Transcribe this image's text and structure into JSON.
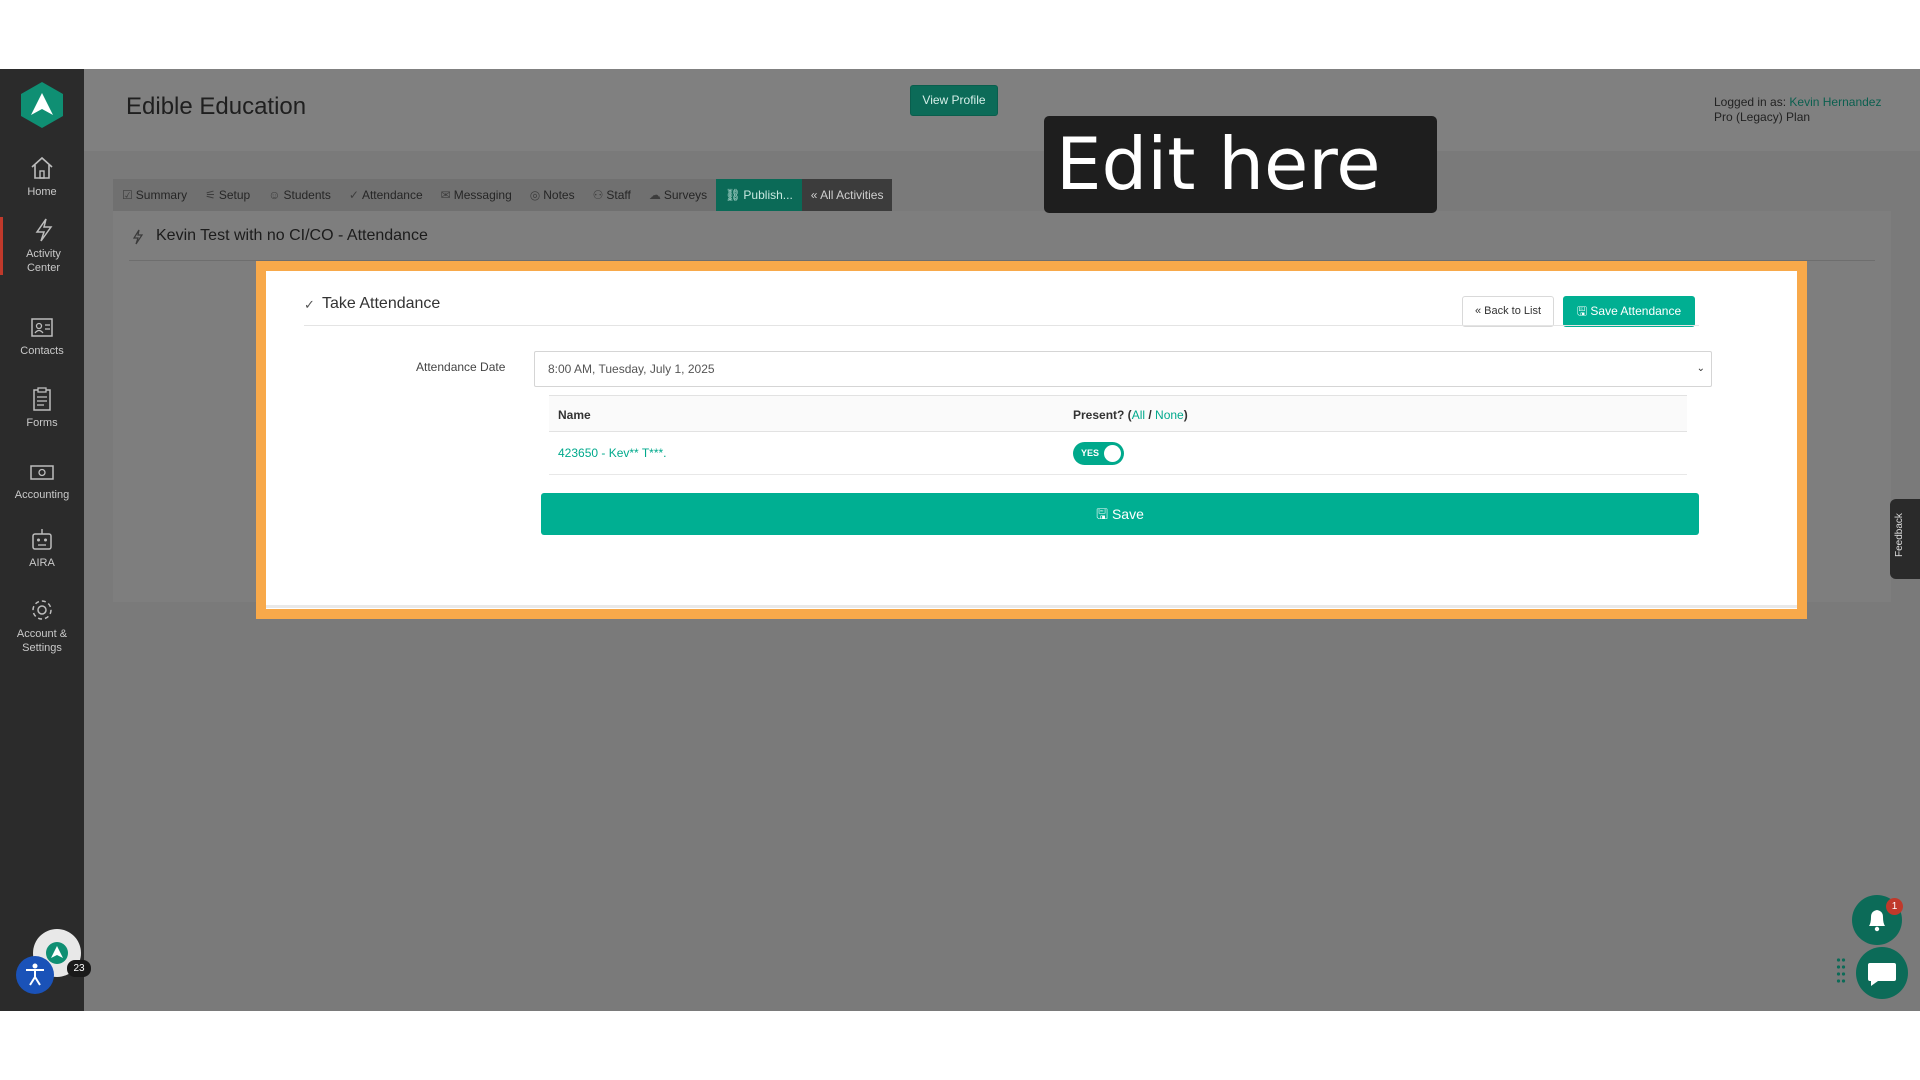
{
  "sidebar": {
    "items": [
      {
        "label_1": "Home",
        "label_2": ""
      },
      {
        "label_1": "Activity",
        "label_2": "Center"
      },
      {
        "label_1": "Contacts",
        "label_2": ""
      },
      {
        "label_1": "Forms",
        "label_2": ""
      },
      {
        "label_1": "Accounting",
        "label_2": ""
      },
      {
        "label_1": "AIRA",
        "label_2": ""
      },
      {
        "label_1": "Account &",
        "label_2": "Settings"
      }
    ],
    "avatar_badge": "23"
  },
  "header": {
    "org_name": "Edible Education",
    "view_profile_label": "View Profile",
    "logged_in_prefix": "Logged in as: ",
    "user_name": "Kevin Hernandez",
    "plan": "Pro (Legacy) Plan"
  },
  "tabs": [
    {
      "label": "Summary"
    },
    {
      "label": "Setup"
    },
    {
      "label": "Students"
    },
    {
      "label": "Attendance"
    },
    {
      "label": "Messaging"
    },
    {
      "label": "Notes"
    },
    {
      "label": "Staff"
    },
    {
      "label": "Surveys"
    },
    {
      "label": "Publish..."
    },
    {
      "label": "« All Activities"
    }
  ],
  "panel": {
    "title": "Kevin Test with no CI/CO - Attendance"
  },
  "attendance": {
    "title": "Take Attendance",
    "back_label": "« Back to List",
    "save_attendance_label": "Save Attendance",
    "date_label": "Attendance Date",
    "date_value": "8:00 AM, Tuesday, July 1, 2025",
    "col_name": "Name",
    "col_present_prefix": "Present? (",
    "col_present_all": "All",
    "col_present_sep": " / ",
    "col_present_none": "None",
    "col_present_suffix": ")",
    "rows": [
      {
        "name": "423650 - Kev** T***.",
        "present_label": "YES"
      }
    ],
    "save_label": "Save"
  },
  "callout": {
    "text": "Edit here"
  },
  "widgets": {
    "feedback_label": "Feedback",
    "notification_count": "1"
  },
  "colors": {
    "accent": "#00af92",
    "highlight": "#f8a94a",
    "sidebar_bg": "#2b2b2b"
  }
}
